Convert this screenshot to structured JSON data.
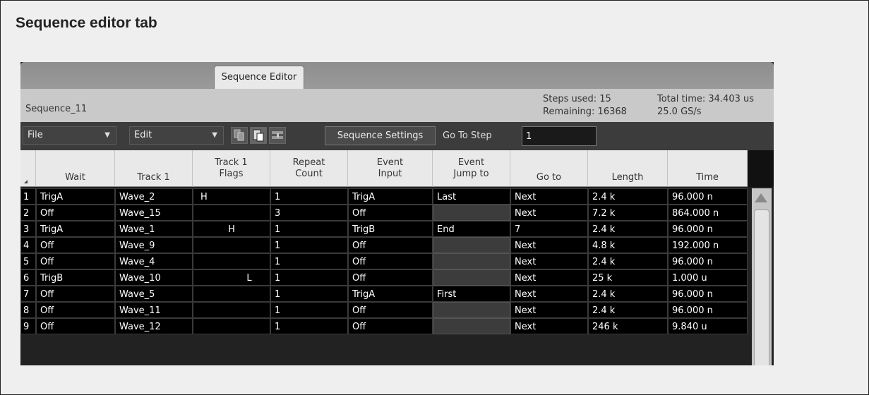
{
  "heading": "Sequence editor tab",
  "tab": {
    "label": "Sequence Editor"
  },
  "info": {
    "sequence_name": "Sequence_11",
    "steps_used": "Steps used: 15",
    "remaining": "Remaining: 16368",
    "total_time": "Total time: 34.403 us",
    "sample_rate": "25.0 GS/s"
  },
  "toolbar": {
    "file_label": "File",
    "edit_label": "Edit",
    "sequence_settings_label": "Sequence Settings",
    "goto_step_label": "Go To Step",
    "goto_step_value": "1",
    "icons": [
      "copy-steps-icon",
      "paste-steps-icon",
      "insert-step-icon"
    ]
  },
  "table": {
    "headers": [
      {
        "line1": "",
        "line2": ""
      },
      {
        "line1": "",
        "line2": "Wait"
      },
      {
        "line1": "",
        "line2": "Track 1"
      },
      {
        "line1": "Track 1",
        "line2": "Flags"
      },
      {
        "line1": "Repeat",
        "line2": "Count"
      },
      {
        "line1": "Event",
        "line2": "Input"
      },
      {
        "line1": "Event",
        "line2": "Jump to"
      },
      {
        "line1": "",
        "line2": "Go to"
      },
      {
        "line1": "",
        "line2": "Length"
      },
      {
        "line1": "",
        "line2": "Time"
      }
    ],
    "rows": [
      {
        "num": "1",
        "wait": "TrigA",
        "track": "Wave_2",
        "flags": "H",
        "repeat": "1",
        "event_input": "TrigA",
        "jump_to": "Last",
        "go_to": "Next",
        "length": "2.4 k",
        "time": "96.000 n"
      },
      {
        "num": "2",
        "wait": "Off",
        "track": "Wave_15",
        "flags": "",
        "repeat": "3",
        "event_input": "Off",
        "jump_to": "",
        "go_to": "Next",
        "length": "7.2 k",
        "time": "864.000 n"
      },
      {
        "num": "3",
        "wait": "TrigA",
        "track": "Wave_1",
        "flags": "H",
        "repeat": "1",
        "event_input": "TrigB",
        "jump_to": "End",
        "go_to": "7",
        "length": "2.4 k",
        "time": "96.000 n"
      },
      {
        "num": "4",
        "wait": "Off",
        "track": "Wave_9",
        "flags": "",
        "repeat": "1",
        "event_input": "Off",
        "jump_to": "",
        "go_to": "Next",
        "length": "4.8 k",
        "time": "192.000 n"
      },
      {
        "num": "5",
        "wait": "Off",
        "track": "Wave_4",
        "flags": "",
        "repeat": "1",
        "event_input": "Off",
        "jump_to": "",
        "go_to": "Next",
        "length": "2.4 k",
        "time": "96.000 n"
      },
      {
        "num": "6",
        "wait": "TrigB",
        "track": "Wave_10",
        "flags": "L",
        "repeat": "1",
        "event_input": "Off",
        "jump_to": "",
        "go_to": "Next",
        "length": "25 k",
        "time": "1.000 u"
      },
      {
        "num": "7",
        "wait": "Off",
        "track": "Wave_5",
        "flags": "",
        "repeat": "1",
        "event_input": "TrigA",
        "jump_to": "First",
        "go_to": "Next",
        "length": "2.4 k",
        "time": "96.000 n"
      },
      {
        "num": "8",
        "wait": "Off",
        "track": "Wave_11",
        "flags": "",
        "repeat": "1",
        "event_input": "Off",
        "jump_to": "",
        "go_to": "Next",
        "length": "2.4 k",
        "time": "96.000 n"
      },
      {
        "num": "9",
        "wait": "Off",
        "track": "Wave_12",
        "flags": "",
        "repeat": "1",
        "event_input": "Off",
        "jump_to": "",
        "go_to": "Next",
        "length": "246 k",
        "time": "9.840 u"
      }
    ]
  },
  "colors": {
    "background": "#efefef",
    "tabbar": "#8e8e8e",
    "infobar": "#c9c9c9",
    "toolbar": "#3c3c3c",
    "cell_bg": "#000000",
    "cell_text": "#ffffff"
  }
}
